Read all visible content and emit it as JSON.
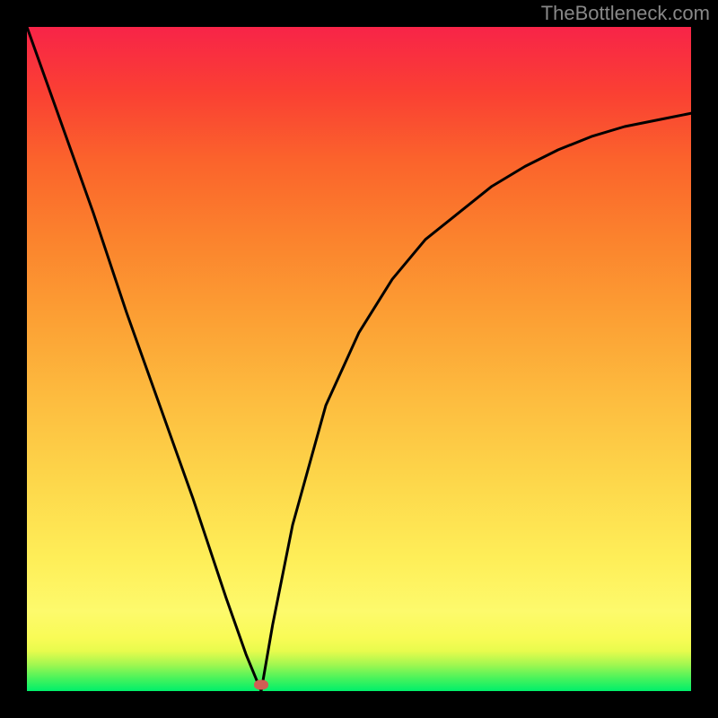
{
  "watermark": "TheBottleneck.com",
  "marker": {
    "x_frac": 0.3527,
    "y_frac": 0.99
  },
  "chart_data": {
    "type": "line",
    "title": "",
    "xlabel": "",
    "ylabel": "",
    "xlim": [
      0,
      100
    ],
    "ylim": [
      0,
      100
    ],
    "bottleneck_point": {
      "x": 35.27,
      "y": 0
    },
    "left_curve": {
      "x": [
        0,
        5,
        10,
        15,
        20,
        25,
        27,
        30,
        33,
        35.27
      ],
      "y": [
        100,
        86,
        72,
        57,
        43,
        29,
        23,
        14,
        5.5,
        0
      ]
    },
    "right_curve": {
      "x": [
        35.27,
        37,
        40,
        45,
        50,
        55,
        60,
        65,
        70,
        75,
        80,
        85,
        90,
        95,
        100
      ],
      "y": [
        0,
        10,
        25,
        43,
        54,
        62,
        68,
        72,
        76,
        79,
        81.5,
        83.5,
        85,
        86,
        87
      ]
    },
    "marker_label": "",
    "colors": {
      "curve": "#000000",
      "marker": "#d15e54",
      "gradient_top": "#f82448",
      "gradient_bottom": "#00ef6a"
    }
  }
}
